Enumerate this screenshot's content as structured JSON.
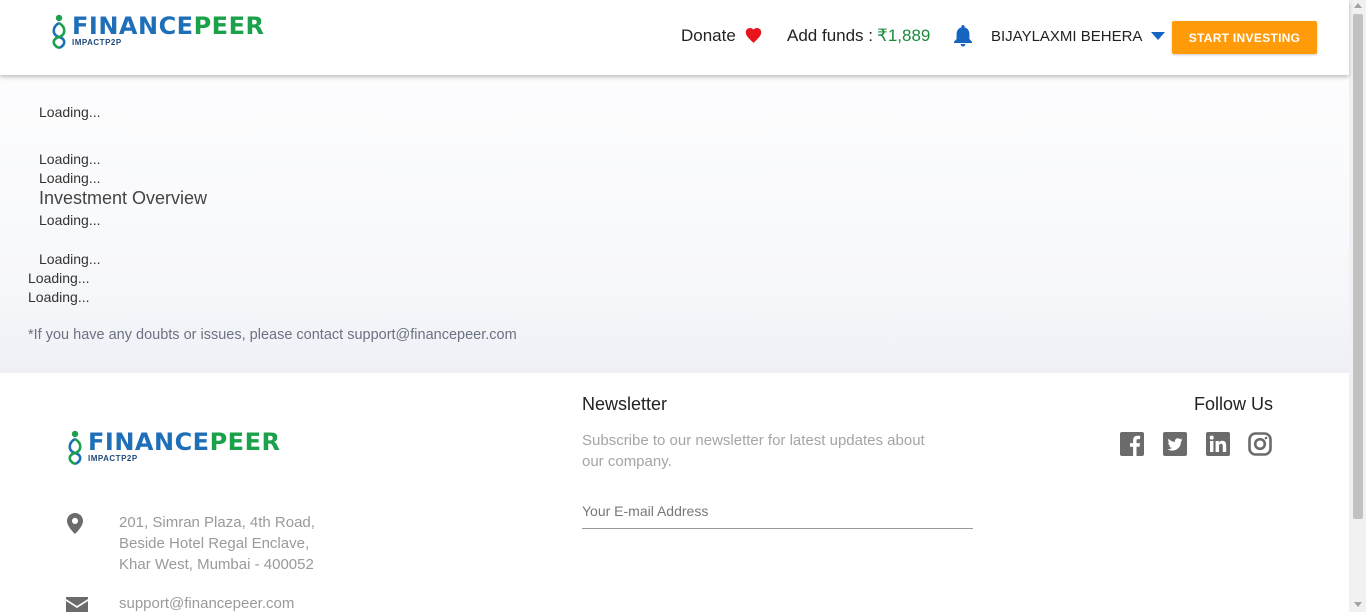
{
  "brand": {
    "name_part1": "FINANCE",
    "name_part2": "PEER",
    "tagline": "IMPACTP2P"
  },
  "header": {
    "donate_label": "Donate",
    "add_funds_label": "Add funds :",
    "add_funds_amount": "₹1,889",
    "user_name": "BIJAYLAXMI BEHERA",
    "start_investing_label": "START INVESTING",
    "icons": [
      "heart-icon",
      "bell-icon",
      "caret-down-icon"
    ]
  },
  "main": {
    "loading_text": "Loading...",
    "investment_overview": "Investment Overview",
    "support_note": "*If you have any doubts or issues, please contact support@financepeer.com"
  },
  "footer": {
    "address_lines": [
      "201, Simran Plaza, 4th Road,",
      "Beside Hotel Regal Enclave,",
      "Khar West, Mumbai - 400052"
    ],
    "email": "support@financepeer.com",
    "newsletter_title": "Newsletter",
    "newsletter_desc": "Subscribe to our newsletter for latest updates about our company.",
    "email_placeholder": "Your E-mail Address",
    "follow_title": "Follow Us",
    "social_icons": [
      "facebook-icon",
      "twitter-icon",
      "linkedin-icon",
      "instagram-icon"
    ]
  },
  "colors": {
    "accent_orange": "#ff9a08",
    "brand_blue": "#1f6fb8",
    "brand_green": "#1aa14a",
    "funds_green": "#1b8a3a",
    "heart_red": "#e8141e",
    "bell_blue": "#1565c0"
  }
}
